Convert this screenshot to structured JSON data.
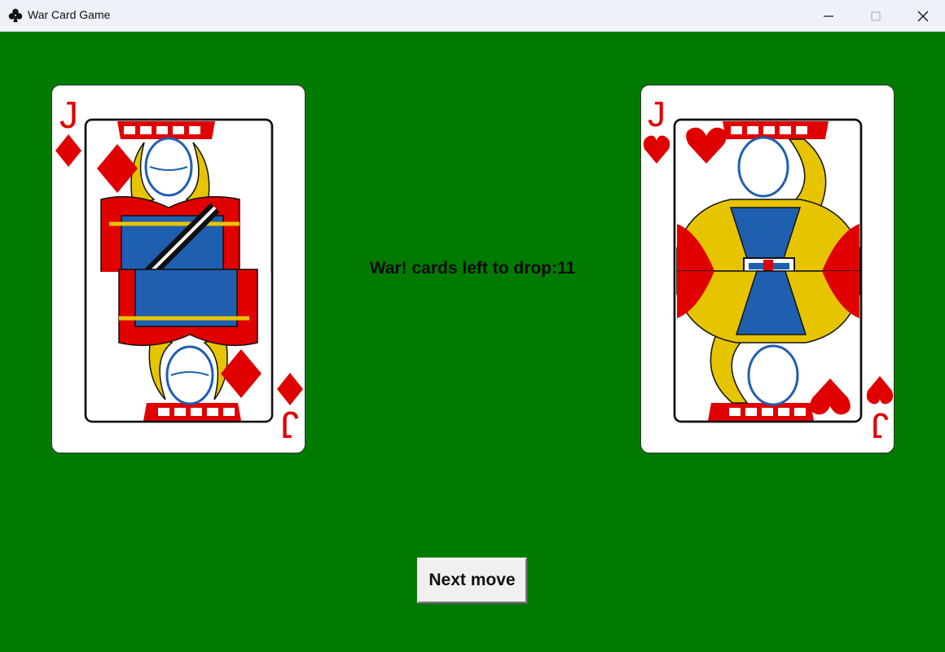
{
  "window": {
    "title": "War Card Game",
    "icon": "club-icon"
  },
  "controls": {
    "minimize": "minimize-icon",
    "maximize": "maximize-icon",
    "close": "close-icon"
  },
  "colors": {
    "table": "#007a00",
    "red_suit": "#e00000",
    "royal_blue": "#1f5fb0",
    "gold": "#e7c400"
  },
  "left_card": {
    "rank": "J",
    "suit": "diamonds",
    "suit_symbol": "♦"
  },
  "right_card": {
    "rank": "J",
    "suit": "hearts",
    "suit_symbol": "♥"
  },
  "status": "War! cards left to drop:11",
  "next_button": {
    "label": "Next move"
  }
}
